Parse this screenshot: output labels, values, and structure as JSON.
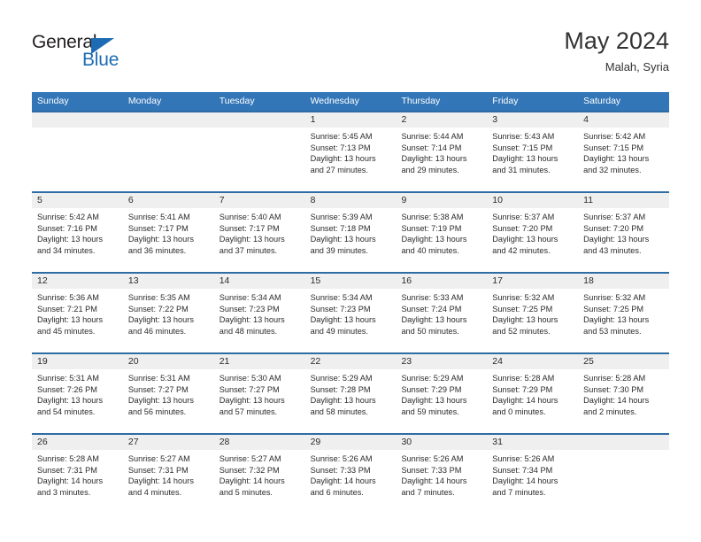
{
  "brand": {
    "name_top": "General",
    "name_bottom": "Blue",
    "triangle_color": "#1d6cb3",
    "text_color": "#231f20"
  },
  "header": {
    "title": "May 2024",
    "subtitle": "Malah, Syria",
    "accent_color": "#3376b8",
    "separator_color": "#2e6da4",
    "dateband_color": "#efefef"
  },
  "columns": [
    "Sunday",
    "Monday",
    "Tuesday",
    "Wednesday",
    "Thursday",
    "Friday",
    "Saturday"
  ],
  "weeks": [
    [
      {
        "day": "",
        "sunrise": "",
        "sunset": "",
        "daylight_line1": "",
        "daylight_line2": ""
      },
      {
        "day": "",
        "sunrise": "",
        "sunset": "",
        "daylight_line1": "",
        "daylight_line2": ""
      },
      {
        "day": "",
        "sunrise": "",
        "sunset": "",
        "daylight_line1": "",
        "daylight_line2": ""
      },
      {
        "day": "1",
        "sunrise": "Sunrise: 5:45 AM",
        "sunset": "Sunset: 7:13 PM",
        "daylight_line1": "Daylight: 13 hours",
        "daylight_line2": "and 27 minutes."
      },
      {
        "day": "2",
        "sunrise": "Sunrise: 5:44 AM",
        "sunset": "Sunset: 7:14 PM",
        "daylight_line1": "Daylight: 13 hours",
        "daylight_line2": "and 29 minutes."
      },
      {
        "day": "3",
        "sunrise": "Sunrise: 5:43 AM",
        "sunset": "Sunset: 7:15 PM",
        "daylight_line1": "Daylight: 13 hours",
        "daylight_line2": "and 31 minutes."
      },
      {
        "day": "4",
        "sunrise": "Sunrise: 5:42 AM",
        "sunset": "Sunset: 7:15 PM",
        "daylight_line1": "Daylight: 13 hours",
        "daylight_line2": "and 32 minutes."
      }
    ],
    [
      {
        "day": "5",
        "sunrise": "Sunrise: 5:42 AM",
        "sunset": "Sunset: 7:16 PM",
        "daylight_line1": "Daylight: 13 hours",
        "daylight_line2": "and 34 minutes."
      },
      {
        "day": "6",
        "sunrise": "Sunrise: 5:41 AM",
        "sunset": "Sunset: 7:17 PM",
        "daylight_line1": "Daylight: 13 hours",
        "daylight_line2": "and 36 minutes."
      },
      {
        "day": "7",
        "sunrise": "Sunrise: 5:40 AM",
        "sunset": "Sunset: 7:17 PM",
        "daylight_line1": "Daylight: 13 hours",
        "daylight_line2": "and 37 minutes."
      },
      {
        "day": "8",
        "sunrise": "Sunrise: 5:39 AM",
        "sunset": "Sunset: 7:18 PM",
        "daylight_line1": "Daylight: 13 hours",
        "daylight_line2": "and 39 minutes."
      },
      {
        "day": "9",
        "sunrise": "Sunrise: 5:38 AM",
        "sunset": "Sunset: 7:19 PM",
        "daylight_line1": "Daylight: 13 hours",
        "daylight_line2": "and 40 minutes."
      },
      {
        "day": "10",
        "sunrise": "Sunrise: 5:37 AM",
        "sunset": "Sunset: 7:20 PM",
        "daylight_line1": "Daylight: 13 hours",
        "daylight_line2": "and 42 minutes."
      },
      {
        "day": "11",
        "sunrise": "Sunrise: 5:37 AM",
        "sunset": "Sunset: 7:20 PM",
        "daylight_line1": "Daylight: 13 hours",
        "daylight_line2": "and 43 minutes."
      }
    ],
    [
      {
        "day": "12",
        "sunrise": "Sunrise: 5:36 AM",
        "sunset": "Sunset: 7:21 PM",
        "daylight_line1": "Daylight: 13 hours",
        "daylight_line2": "and 45 minutes."
      },
      {
        "day": "13",
        "sunrise": "Sunrise: 5:35 AM",
        "sunset": "Sunset: 7:22 PM",
        "daylight_line1": "Daylight: 13 hours",
        "daylight_line2": "and 46 minutes."
      },
      {
        "day": "14",
        "sunrise": "Sunrise: 5:34 AM",
        "sunset": "Sunset: 7:23 PM",
        "daylight_line1": "Daylight: 13 hours",
        "daylight_line2": "and 48 minutes."
      },
      {
        "day": "15",
        "sunrise": "Sunrise: 5:34 AM",
        "sunset": "Sunset: 7:23 PM",
        "daylight_line1": "Daylight: 13 hours",
        "daylight_line2": "and 49 minutes."
      },
      {
        "day": "16",
        "sunrise": "Sunrise: 5:33 AM",
        "sunset": "Sunset: 7:24 PM",
        "daylight_line1": "Daylight: 13 hours",
        "daylight_line2": "and 50 minutes."
      },
      {
        "day": "17",
        "sunrise": "Sunrise: 5:32 AM",
        "sunset": "Sunset: 7:25 PM",
        "daylight_line1": "Daylight: 13 hours",
        "daylight_line2": "and 52 minutes."
      },
      {
        "day": "18",
        "sunrise": "Sunrise: 5:32 AM",
        "sunset": "Sunset: 7:25 PM",
        "daylight_line1": "Daylight: 13 hours",
        "daylight_line2": "and 53 minutes."
      }
    ],
    [
      {
        "day": "19",
        "sunrise": "Sunrise: 5:31 AM",
        "sunset": "Sunset: 7:26 PM",
        "daylight_line1": "Daylight: 13 hours",
        "daylight_line2": "and 54 minutes."
      },
      {
        "day": "20",
        "sunrise": "Sunrise: 5:31 AM",
        "sunset": "Sunset: 7:27 PM",
        "daylight_line1": "Daylight: 13 hours",
        "daylight_line2": "and 56 minutes."
      },
      {
        "day": "21",
        "sunrise": "Sunrise: 5:30 AM",
        "sunset": "Sunset: 7:27 PM",
        "daylight_line1": "Daylight: 13 hours",
        "daylight_line2": "and 57 minutes."
      },
      {
        "day": "22",
        "sunrise": "Sunrise: 5:29 AM",
        "sunset": "Sunset: 7:28 PM",
        "daylight_line1": "Daylight: 13 hours",
        "daylight_line2": "and 58 minutes."
      },
      {
        "day": "23",
        "sunrise": "Sunrise: 5:29 AM",
        "sunset": "Sunset: 7:29 PM",
        "daylight_line1": "Daylight: 13 hours",
        "daylight_line2": "and 59 minutes."
      },
      {
        "day": "24",
        "sunrise": "Sunrise: 5:28 AM",
        "sunset": "Sunset: 7:29 PM",
        "daylight_line1": "Daylight: 14 hours",
        "daylight_line2": "and 0 minutes."
      },
      {
        "day": "25",
        "sunrise": "Sunrise: 5:28 AM",
        "sunset": "Sunset: 7:30 PM",
        "daylight_line1": "Daylight: 14 hours",
        "daylight_line2": "and 2 minutes."
      }
    ],
    [
      {
        "day": "26",
        "sunrise": "Sunrise: 5:28 AM",
        "sunset": "Sunset: 7:31 PM",
        "daylight_line1": "Daylight: 14 hours",
        "daylight_line2": "and 3 minutes."
      },
      {
        "day": "27",
        "sunrise": "Sunrise: 5:27 AM",
        "sunset": "Sunset: 7:31 PM",
        "daylight_line1": "Daylight: 14 hours",
        "daylight_line2": "and 4 minutes."
      },
      {
        "day": "28",
        "sunrise": "Sunrise: 5:27 AM",
        "sunset": "Sunset: 7:32 PM",
        "daylight_line1": "Daylight: 14 hours",
        "daylight_line2": "and 5 minutes."
      },
      {
        "day": "29",
        "sunrise": "Sunrise: 5:26 AM",
        "sunset": "Sunset: 7:33 PM",
        "daylight_line1": "Daylight: 14 hours",
        "daylight_line2": "and 6 minutes."
      },
      {
        "day": "30",
        "sunrise": "Sunrise: 5:26 AM",
        "sunset": "Sunset: 7:33 PM",
        "daylight_line1": "Daylight: 14 hours",
        "daylight_line2": "and 7 minutes."
      },
      {
        "day": "31",
        "sunrise": "Sunrise: 5:26 AM",
        "sunset": "Sunset: 7:34 PM",
        "daylight_line1": "Daylight: 14 hours",
        "daylight_line2": "and 7 minutes."
      },
      {
        "day": "",
        "sunrise": "",
        "sunset": "",
        "daylight_line1": "",
        "daylight_line2": ""
      }
    ]
  ]
}
